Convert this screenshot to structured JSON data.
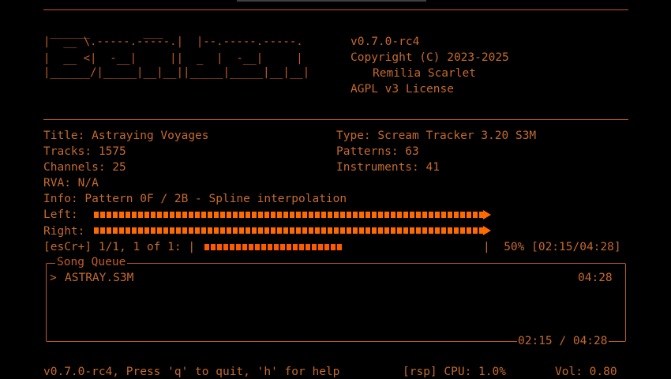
{
  "header": {
    "logo_lines": [
      " ______        ___                                ",
      "|  __ \\.-----.-----.|  |--.-----.-----.",
      "|  __ <|  -__|     ||  _  |  -__|     |",
      "|______/|_____|__|__||_____|_____|__|__|"
    ],
    "version": "v0.7.0-rc4",
    "copyright": "Copyright (C) 2023-2025",
    "author": "Remilia Scarlet",
    "license": "AGPL v3 License"
  },
  "info": {
    "title": "Title: Astraying Voyages",
    "type": "Type: Scream Tracker 3.20 S3M",
    "tracks": "Tracks: 1575",
    "patterns": "Patterns: 63",
    "channels": "Channels: 25",
    "instruments": "Instruments: 41",
    "rva": "RVA: N/A",
    "info_line": "Info: Pattern 0F / 2B - Spline interpolation",
    "left_label": "Left:",
    "right_label": "Right:",
    "left_level": 0.88,
    "right_level": 0.88
  },
  "progress": {
    "prefix": "[esCr+] 1/1, 1 of 1: |",
    "suffix": "|  50% [02:15/04:28]",
    "fraction": 0.5
  },
  "queue": {
    "title": "Song Queue",
    "items": [
      {
        "marker": ">",
        "name": "ASTRAY.S3M",
        "duration": "04:28"
      }
    ],
    "footer": "02:15 / 04:28"
  },
  "status": {
    "left": "v0.7.0-rc4, Press 'q' to quit, 'h' for help",
    "rsp": "[rsp] CPU: 1.0%",
    "volume": "Vol: 0.80"
  }
}
